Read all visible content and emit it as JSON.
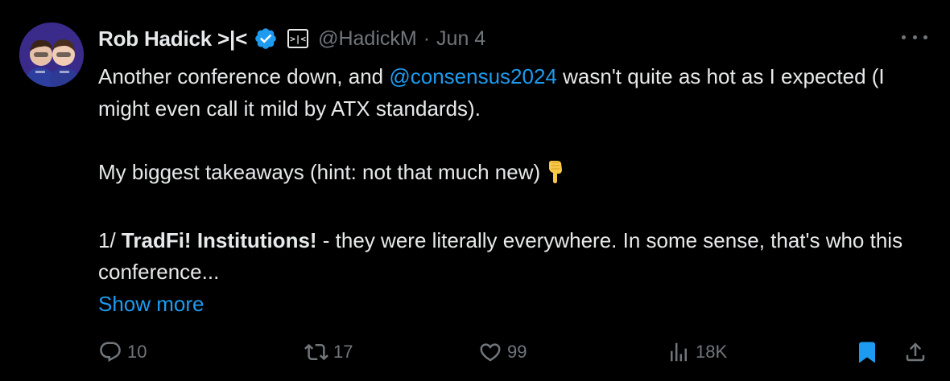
{
  "author": {
    "display_name": "Rob Hadick >|<",
    "affiliation_badge": ">|<",
    "handle": "@HadickM",
    "separator": "·",
    "date": "Jun 4"
  },
  "tweet": {
    "line1_prefix": "Another conference down, and ",
    "mention": "@consensus2024",
    "line1_suffix": " wasn't quite as hot as I expected (I might even call it mild by ATX standards).",
    "para2": "My biggest takeaways (hint: not that much new)",
    "para2_emoji": "point-down-emoji",
    "para3_prefix": "1/ ",
    "para3_bold": "TradFi! Institutions!",
    "para3_suffix": " - they were literally everywhere. In some sense, that's who this conference...",
    "show_more": "Show more"
  },
  "actions": {
    "replies": "10",
    "reposts": "17",
    "likes": "99",
    "views": "18K"
  },
  "colors": {
    "background": "#000000",
    "text": "#e7e9ea",
    "muted": "#71767b",
    "accent": "#1d9bf0"
  },
  "icons": [
    "verified-badge-icon",
    "more-options-icon",
    "reply-icon",
    "repost-icon",
    "like-icon",
    "views-icon",
    "bookmark-icon",
    "share-icon"
  ]
}
